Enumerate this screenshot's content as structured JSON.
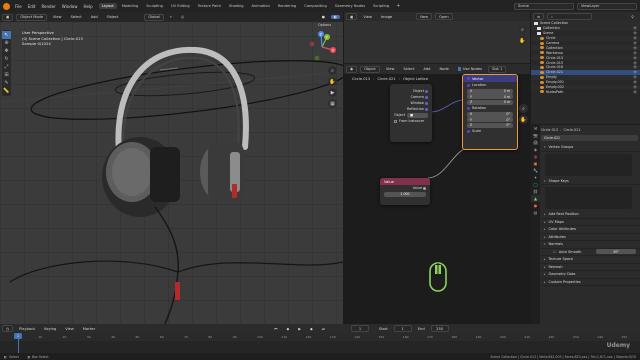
{
  "topbar": {
    "menus": [
      "File",
      "Edit",
      "Render",
      "Window",
      "Help"
    ],
    "workspaces": [
      "Layout",
      "Modeling",
      "Sculpting",
      "UV Editing",
      "Texture Paint",
      "Shading",
      "Animation",
      "Rendering",
      "Compositing",
      "Geometry Nodes",
      "Scripting"
    ],
    "active_workspace": "Layout",
    "scene": "Scene",
    "view_layer": "ViewLayer"
  },
  "viewport": {
    "mode": "Object Mode",
    "menus": [
      "View",
      "Select",
      "Add",
      "Object"
    ],
    "transform": "Global",
    "options": "Options",
    "info_line1": "User Perspective",
    "info_line2": "(0) Scene Collection | Circle.013",
    "info_line3": "Sample 0/1024"
  },
  "gizmo": {
    "x": "X",
    "y": "Y",
    "z": "Z"
  },
  "image_editor": {
    "menus": [
      "View",
      "Image"
    ],
    "new_label": "New",
    "open_label": "Open"
  },
  "node_editor": {
    "object_label": "Object",
    "menus": [
      "View",
      "Select",
      "Add",
      "Node"
    ],
    "use_nodes": "Use Nodes",
    "slot": "Slot 1",
    "breadcrumb": [
      "Circle.013",
      "Circle.021",
      "Object Lattice"
    ],
    "mapping_node": {
      "vector_label": "Vector",
      "location_label": "Location",
      "rotation_label": "Rotation",
      "scale_label": "Scale",
      "location": [
        {
          "axis": "X",
          "value": "0 m"
        },
        {
          "axis": "Y",
          "value": "0 m"
        },
        {
          "axis": "Z",
          "value": "0 m"
        }
      ],
      "rotation": [
        {
          "axis": "X",
          "value": "0°"
        },
        {
          "axis": "Y",
          "value": "0°"
        },
        {
          "axis": "Z",
          "value": "0°"
        }
      ]
    },
    "texcoord_node": {
      "outputs": [
        "Object",
        "Camera",
        "Window",
        "Reflection"
      ],
      "object_field": "Object",
      "from_instancer": "From Instancer"
    },
    "value_node": {
      "title": "Value",
      "output": "Value",
      "value": "1.000"
    }
  },
  "outliner": {
    "header": "Scene Collection",
    "items": [
      {
        "label": "Collection",
        "color": "#e0e0e0"
      },
      {
        "label": "Scene",
        "color": "#e0e0e0"
      },
      {
        "label": "Circle",
        "color": "#d88f36"
      },
      {
        "label": "Camera",
        "color": "#d88f36"
      },
      {
        "label": "Collection",
        "color": "#d88f36"
      },
      {
        "label": "Workshop",
        "color": "#d88f36"
      },
      {
        "label": "Circle.013",
        "color": "#d88f36"
      },
      {
        "label": "Circle.015",
        "color": "#d88f36"
      },
      {
        "label": "Circle.016",
        "color": "#d88f36"
      },
      {
        "label": "Circle.021",
        "color": "#d88f36"
      },
      {
        "label": "Empty",
        "color": "#d88f36"
      },
      {
        "label": "Empty.001",
        "color": "#d88f36"
      },
      {
        "label": "Empty.002",
        "color": "#d88f36"
      },
      {
        "label": "NurbsPath",
        "color": "#d88f36"
      }
    ]
  },
  "properties": {
    "breadcrumb": [
      "Circle.013",
      "Circle.021"
    ],
    "name": "Circle.021",
    "sections": [
      "Vertex Groups",
      "Shape Keys",
      "Add Rest Position",
      "UV Maps",
      "Color Attributes",
      "Attributes",
      "Normals",
      "Auto Smooth",
      "Texture Space",
      "Remesh",
      "Geometry Data",
      "Custom Properties"
    ],
    "auto_smooth_value": "30°"
  },
  "timeline": {
    "menus": [
      "Playback",
      "Keying",
      "View",
      "Marker"
    ],
    "current_frame": "1",
    "start_label": "Start",
    "start": "1",
    "end_label": "End",
    "end": "250",
    "frame_ticks": [
      "0",
      "10",
      "20",
      "30",
      "40",
      "50",
      "60",
      "70",
      "80",
      "90",
      "100",
      "110",
      "120",
      "130",
      "140",
      "150",
      "160",
      "170",
      "180",
      "190",
      "200",
      "210",
      "220",
      "230",
      "240",
      "250"
    ]
  },
  "status": {
    "left": "Select",
    "middle": "Box Select",
    "right": "Scene Collection | Circle.013 | Verts:842,003 | Faces:823,xxx | Tris:1,671,xxx | Objects:0/15",
    "watermark": "Udemy"
  },
  "colors": {
    "accent": "#4772b3",
    "value_node_header": "#83314a",
    "mapping_node_header": "#3c3c83",
    "cable_red": "#b32a2a"
  }
}
